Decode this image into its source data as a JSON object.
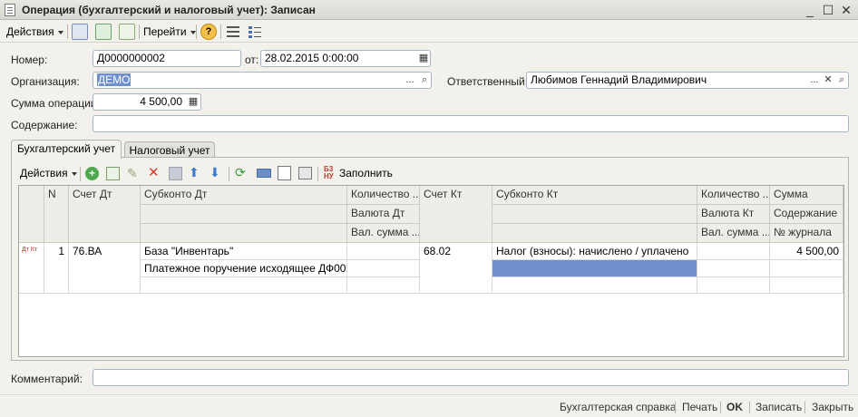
{
  "window": {
    "title": "Операция (бухгалтерский и налоговый учет): Записан"
  },
  "toolbar": {
    "actions_label": "Действия",
    "goto_label": "Перейти",
    "icons": [
      "post-icon",
      "structure-icon",
      "copy-doc-icon",
      "help-icon",
      "list-icon",
      "settings-icon"
    ]
  },
  "form": {
    "number_label": "Номер:",
    "number_value": "Д0000000002",
    "date_label": "от:",
    "date_value": "28.02.2015  0:00:00",
    "org_label": "Организация:",
    "org_value": "ДЕМО",
    "responsible_label": "Ответственный:",
    "responsible_value": "Любимов Геннадий Владимирович",
    "sum_label": "Сумма операции:",
    "sum_value": "4 500,00",
    "content_label": "Содержание:",
    "content_value": "",
    "comment_label": "Комментарий:",
    "comment_value": ""
  },
  "tabs": {
    "accounting": "Бухгалтерский учет",
    "tax": "Налоговый учет"
  },
  "grid_toolbar": {
    "actions_label": "Действия",
    "fill_label": "Заполнить"
  },
  "grid": {
    "headers": {
      "n": "N",
      "account_dt": "Счет Дт",
      "subconto_dt": "Субконто Дт",
      "qty_dt": "Количество ...",
      "currency_dt": "Валюта Дт",
      "cur_sum_dt": "Вал. сумма ...",
      "account_kt": "Счет Кт",
      "subconto_kt": "Субконто Кт",
      "qty_kt": "Количество ...",
      "currency_kt": "Валюта Кт",
      "cur_sum_kt": "Вал. сумма ...",
      "sum": "Сумма",
      "content": "Содержание",
      "journal_no": "№ журнала"
    },
    "rows": [
      {
        "type_icon": "Дт Кт",
        "n": "1",
        "account_dt": "76.ВА",
        "subconto_dt_1": "База \"Инвентарь\"",
        "subconto_dt_2": "Платежное поручение исходящее ДФ00...",
        "account_kt": "68.02",
        "subconto_kt_1": "Налог (взносы): начислено / уплачено",
        "sum": "4 500,00"
      }
    ]
  },
  "statusbar": {
    "accounting_report": "Бухгалтерская справка",
    "print": "Печать",
    "ok": "OK",
    "save": "Записать",
    "close": "Закрыть"
  },
  "colors": {
    "selection": "#6f8fcf",
    "window_bg": "#f2f1ec",
    "field_border": "#a9b3c6"
  }
}
